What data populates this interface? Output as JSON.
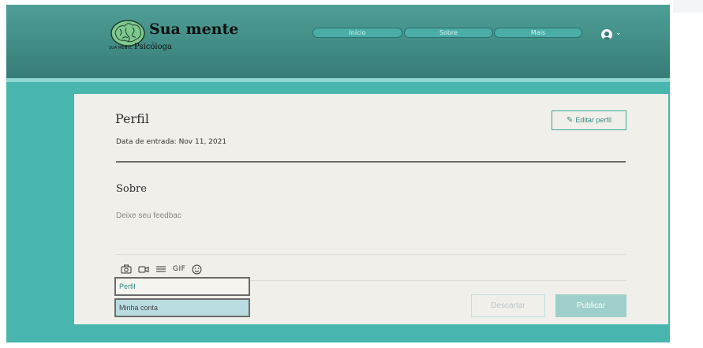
{
  "header": {
    "brand_name": "Sua mente",
    "brand_small": "SUA MENTE",
    "brand_subtitle": "Psicóloga",
    "nav": [
      "Início",
      "Sobre",
      "Mais"
    ],
    "user_menu_icon": "user-avatar-icon",
    "caret_glyph": "⌄"
  },
  "profile": {
    "title": "Perfil",
    "joined": "Data de entrada: Nov 11, 2021",
    "edit_button": "Editar perfil",
    "edit_icon": "pencil-icon"
  },
  "about": {
    "heading": "Sobre",
    "feedback_placeholder": "Deixe seu feedbac",
    "toolbar": {
      "icons": [
        "camera-icon",
        "video-icon",
        "divider-icon",
        "gif-icon",
        "emoji-icon"
      ],
      "gif_label": "GIF"
    },
    "discard_button": "Descartar",
    "publish_button": "Publicar"
  },
  "dropdown": {
    "items": [
      "Perfil",
      "Minha conta"
    ],
    "highlighted_index": 1
  },
  "colors": {
    "header": "#377d78",
    "page": "#48b5ae",
    "card": "#f1efe9",
    "accent": "#3aa79f",
    "publish": "#9fcfca",
    "menu_highlight": "#b9dce1"
  }
}
